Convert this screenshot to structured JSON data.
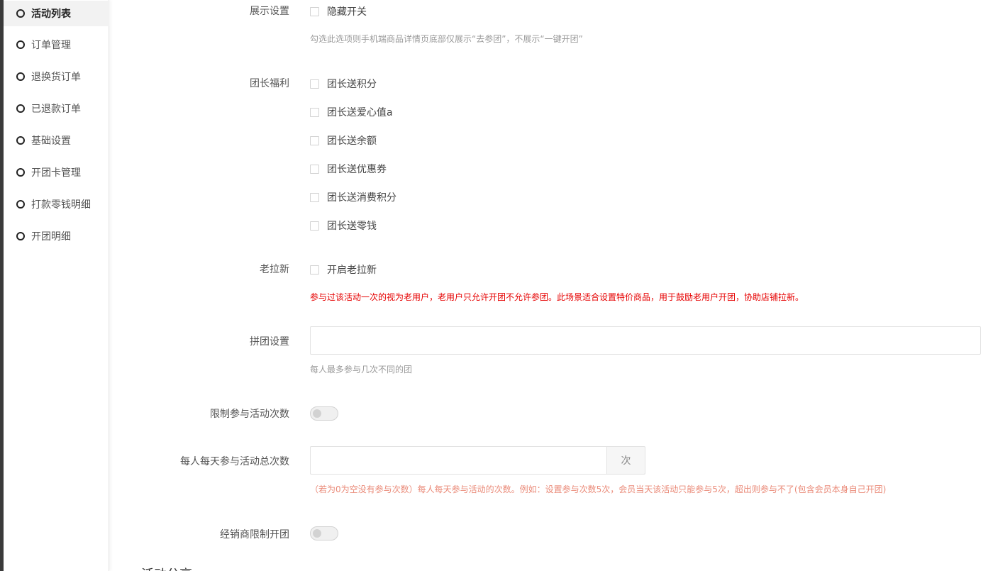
{
  "sidebar": {
    "items": [
      {
        "label": "活动列表",
        "active": true
      },
      {
        "label": "订单管理",
        "active": false
      },
      {
        "label": "退换货订单",
        "active": false
      },
      {
        "label": "已退款订单",
        "active": false
      },
      {
        "label": "基础设置",
        "active": false
      },
      {
        "label": "开团卡管理",
        "active": false
      },
      {
        "label": "打款零钱明细",
        "active": false
      },
      {
        "label": "开团明细",
        "active": false
      }
    ]
  },
  "form": {
    "display": {
      "label": "展示设置",
      "option": "隐藏开关",
      "hint": "勾选此选项则手机端商品详情页底部仅展示“去参团”，不展示“一键开团”"
    },
    "leader_benefits": {
      "label": "团长福利",
      "options": [
        "团长送积分",
        "团长送爱心值a",
        "团长送余额",
        "团长送优惠券",
        "团长送消费积分",
        "团长送零钱"
      ]
    },
    "old_brings_new": {
      "label": "老拉新",
      "option": "开启老拉新",
      "hint": "参与过该活动一次的视为老用户，老用户只允许开团不允许参团。此场景适合设置特价商品，用于鼓励老用户开团，协助店铺拉新。"
    },
    "group_setting": {
      "label": "拼团设置",
      "value": "",
      "hint": "每人最多参与几次不同的团"
    },
    "limit_times": {
      "label": "限制参与活动次数",
      "enabled": false
    },
    "daily_total": {
      "label": "每人每天参与活动总次数",
      "value": "",
      "suffix": "次",
      "hint": "（若为0为空没有参与次数）每人每天参与活动的次数。例如：设置参与次数5次，会员当天该活动只能参与5次，超出则参与不了(包含会员本身自己开团)"
    },
    "dealer_limit": {
      "label": "经销商限制开团",
      "enabled": false
    }
  },
  "next_section": {
    "title": "活动分享"
  }
}
